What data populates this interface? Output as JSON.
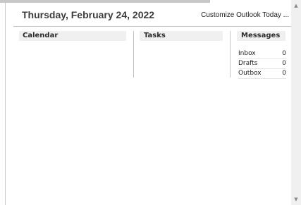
{
  "header": {
    "date": "Thursday, February 24, 2022",
    "customize_link": "Customize Outlook Today ..."
  },
  "sections": {
    "calendar": "Calendar",
    "tasks": "Tasks",
    "messages": "Messages"
  },
  "messages": [
    {
      "label": "Inbox",
      "count": "0"
    },
    {
      "label": "Drafts",
      "count": "0"
    },
    {
      "label": "Outbox",
      "count": "0"
    }
  ],
  "scrollbar": {
    "up_icon": "▲",
    "down_icon": "▼"
  }
}
